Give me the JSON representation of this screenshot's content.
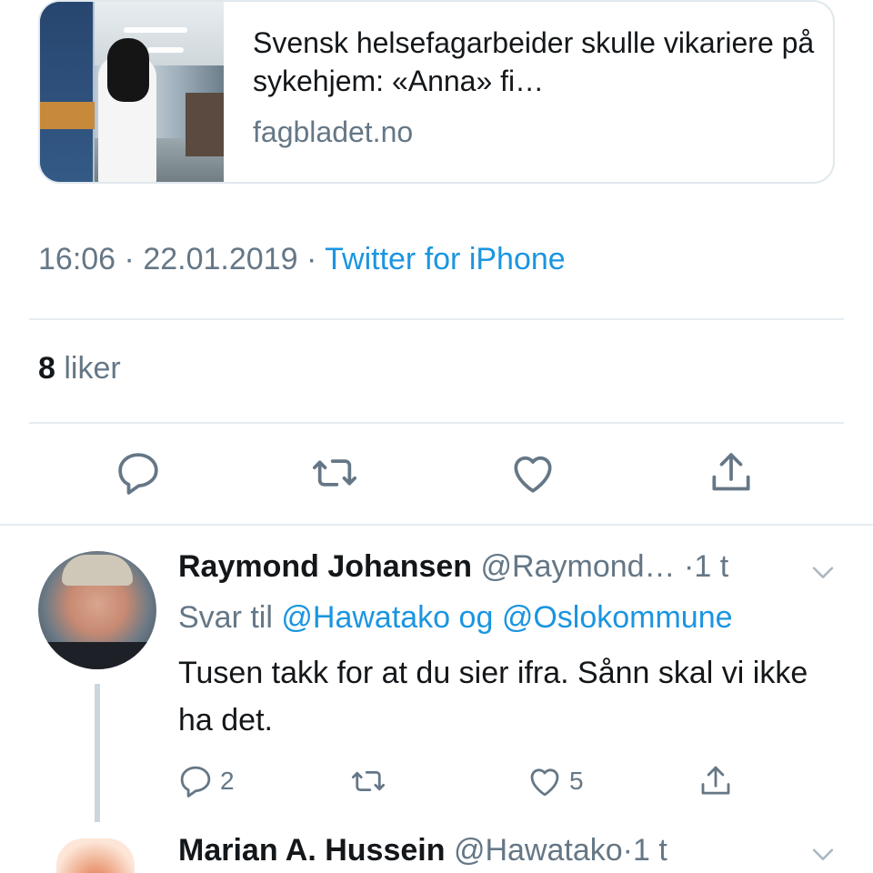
{
  "link_card": {
    "title": "Svensk helsefagarbeider skulle vikariere på sykehjem: «Anna» fi…",
    "domain": "fagbladet.no"
  },
  "tweet_meta": {
    "time": "16:06",
    "separator": "·",
    "date": "22.01.2019",
    "source": "Twitter for iPhone"
  },
  "stats": {
    "likes_count": "8",
    "likes_label": "liker"
  },
  "actions": {
    "reply_icon": "reply-icon",
    "retweet_icon": "retweet-icon",
    "like_icon": "heart-icon",
    "share_icon": "share-icon"
  },
  "reply": {
    "name": "Raymond Johansen",
    "handle": "@Raymond…",
    "dot": "·",
    "time": "1 t",
    "reply_to_prefix": "Svar til",
    "mention_1": "@Hawatako",
    "conjunction": "og",
    "mention_2": "@Oslokommune",
    "text": "Tusen takk for at du sier ifra. Sånn skal vi ikke ha det.",
    "reply_count": "2",
    "retweet_count": "",
    "like_count": "5"
  },
  "next_reply": {
    "name": "Marian A. Hussein",
    "handle": "@Hawatako",
    "dot": "·",
    "time": "1 t"
  },
  "colors": {
    "text": "#14171a",
    "muted": "#657786",
    "link": "#1b95e0",
    "border": "#e6ecf0"
  }
}
